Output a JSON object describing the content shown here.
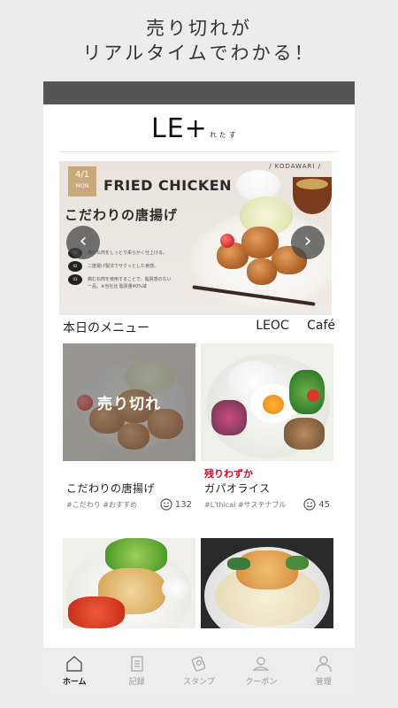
{
  "promo": {
    "line1": "売り切れが",
    "line2": "リアルタイムでわかる！"
  },
  "header": {
    "logo_main": "LE+",
    "logo_sub": "れたす"
  },
  "banner": {
    "date": "4/1",
    "weekday": "MON",
    "title": "FRIED CHICKEN",
    "tag": "/ KODAWARI /",
    "subtitle": "こだわりの唐揚げ",
    "notes": [
      "鶏むね肉をしっとり柔らかく仕上げる。",
      "二度揚げ製法でサクッとした食感。",
      "鶏むね肉を使用することで、脂質感のない一品。※当社比 脂質量40%減"
    ],
    "prev_label": "‹",
    "next_label": "›"
  },
  "section": {
    "title": "本日のメニュー",
    "cafe_leoc": "LEOC",
    "cafe_label": "Café"
  },
  "cards": [
    {
      "overlay": "売り切れ",
      "badge": "",
      "title": "こだわりの唐揚げ",
      "tags": "#こだわり #おすすめ",
      "likes": "132"
    },
    {
      "overlay": "",
      "badge": "残りわずか",
      "title": "ガパオライス",
      "tags": "#L'thical #サステナブル",
      "likes": "45"
    }
  ],
  "tabs": [
    {
      "label": "ホーム",
      "icon": "home-icon"
    },
    {
      "label": "記録",
      "icon": "document-icon"
    },
    {
      "label": "スタンプ",
      "icon": "stamp-icon"
    },
    {
      "label": "クーポン",
      "icon": "coupon-icon"
    },
    {
      "label": "管理",
      "icon": "user-icon"
    }
  ],
  "colors": {
    "accent_red": "#c8102e",
    "statusbar": "#555555",
    "tabbar": "#ededed"
  }
}
